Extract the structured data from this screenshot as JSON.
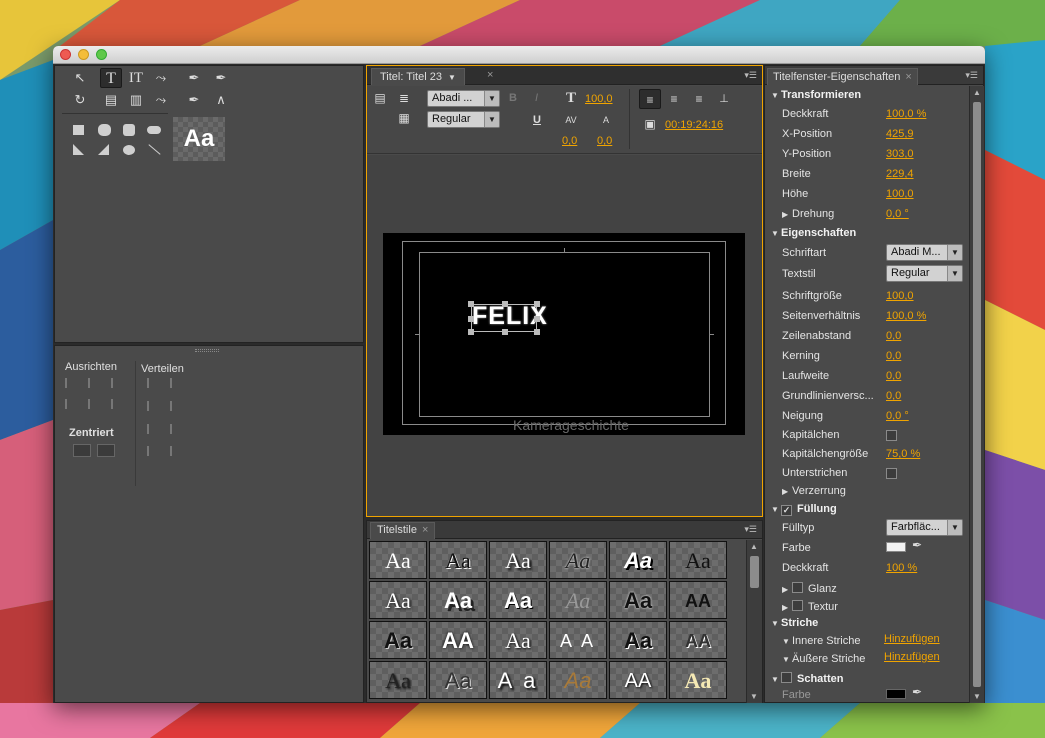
{
  "colors": {
    "accent": "#f0a400",
    "panel": "#4a4a4a",
    "canvas": "#000000"
  },
  "tools": {
    "row1": [
      "selection-tool",
      "type-tool",
      "vertical-type-tool",
      "path-type-tool",
      "pen-tool",
      "add-anchor-tool"
    ],
    "row2": [
      "rotation-tool",
      "area-type-tool",
      "vertical-area-type-tool",
      "vertical-path-type-tool",
      "delete-anchor-tool",
      "convert-anchor-tool"
    ],
    "preview_sample": "Aa"
  },
  "align_panel": {
    "align_heading": "Ausrichten",
    "distribute_heading": "Verteilen",
    "center_heading": "Zentriert"
  },
  "title_panel": {
    "tab_label": "Titel: Titel 23",
    "font_family": "Abadi ...",
    "font_style": "Regular",
    "bold": "B",
    "italic": "I",
    "underline": "U",
    "font_size": "100,0",
    "kerning": "0,0",
    "leading": "0,0",
    "timecode": "00:19:24:16",
    "canvas_text": "FELIX",
    "background_text": "Kamerageschichte"
  },
  "styles_panel": {
    "tab_label": "Titelstile",
    "samples": [
      "Aa",
      "Aa",
      "Aa",
      "Aa",
      "Aa",
      "Aa",
      "Aa",
      "Aa",
      "Aa",
      "Aa",
      "Aa",
      "AA",
      "Aa",
      "AA",
      "Aa",
      "A A",
      "Aa",
      "AA",
      "Aa",
      "Aa",
      "A a",
      "Aa",
      "AA",
      "Aa"
    ]
  },
  "properties_panel": {
    "tab_label": "Titelfenster-Eigenschaften",
    "transform": {
      "heading": "Transformieren",
      "opacity_label": "Deckkraft",
      "opacity": "100,0 %",
      "x_label": "X-Position",
      "x": "425,9",
      "y_label": "Y-Position",
      "y": "303,0",
      "width_label": "Breite",
      "width": "229,4",
      "height_label": "Höhe",
      "height": "100,0",
      "rotation_label": "Drehung",
      "rotation": "0,0 °"
    },
    "properties": {
      "heading": "Eigenschaften",
      "font_label": "Schriftart",
      "font": "Abadi M...",
      "style_label": "Textstil",
      "style": "Regular",
      "size_label": "Schriftgröße",
      "size": "100,0",
      "aspect_label": "Seitenverhältnis",
      "aspect": "100,0 %",
      "leading_label": "Zeilenabstand",
      "leading": "0,0",
      "kerning_label": "Kerning",
      "kerning": "0,0",
      "tracking_label": "Laufweite",
      "tracking": "0,0",
      "baseline_label": "Grundlinienversc...",
      "baseline": "0,0",
      "slant_label": "Neigung",
      "slant": "0,0 °",
      "smallcaps_label": "Kapitälchen",
      "smallcaps_size_label": "Kapitälchengröße",
      "smallcaps_size": "75,0 %",
      "underline_label": "Unterstrichen",
      "distort_label": "Verzerrung"
    },
    "fill": {
      "heading": "Füllung",
      "type_label": "Fülltyp",
      "type": "Farbfläc...",
      "color_label": "Farbe",
      "color": "#f2f2f2",
      "opacity_label": "Deckkraft",
      "opacity": "100 %",
      "sheen_label": "Glanz",
      "texture_label": "Textur"
    },
    "strokes": {
      "heading": "Striche",
      "inner_label": "Innere Striche",
      "inner_add": "Hinzufügen",
      "outer_label": "Äußere Striche",
      "outer_add": "Hinzufügen"
    },
    "shadow": {
      "heading": "Schatten",
      "color_label": "Farbe",
      "color": "#000000"
    }
  }
}
